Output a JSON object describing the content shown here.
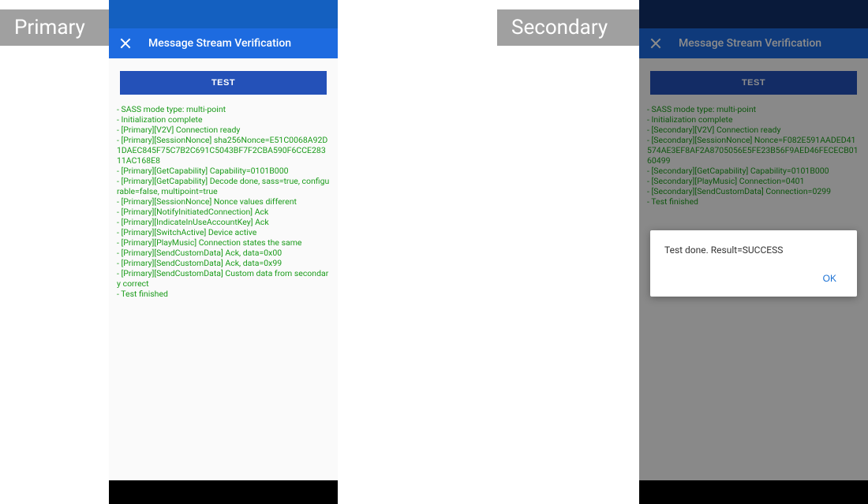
{
  "labels": {
    "primary": "Primary",
    "secondary": "Secondary"
  },
  "app": {
    "title": "Message Stream Verification",
    "test_button": "TEST"
  },
  "primary_log": [
    " - SASS mode type: multi-point",
    " - Initialization complete",
    " - [Primary][V2V] Connection ready",
    " - [Primary][SessionNonce] sha256Nonce=E51C0068A92D1DAEC845F75C7B2C691C5043BF7F2CBA590F6CCE28311AC168E8",
    " - [Primary][GetCapability] Capability=0101B000",
    " - [Primary][GetCapability] Decode done, sass=true, configurable=false, multipoint=true",
    " - [Primary][SessionNonce] Nonce values different",
    " - [Primary][NotifyInitiatedConnection] Ack",
    " - [Primary][IndicateInUseAccountKey] Ack",
    " - [Primary][SwitchActive] Device active",
    " - [Primary][PlayMusic] Connection states the same",
    " - [Primary][SendCustomData] Ack, data=0x00",
    " - [Primary][SendCustomData] Ack, data=0x99",
    " - [Primary][SendCustomData] Custom data from secondary correct",
    " - Test finished"
  ],
  "secondary_log": [
    " - SASS mode type: multi-point",
    " - Initialization complete",
    " - [Secondary][V2V] Connection ready",
    " - [Secondary][SessionNonce] Nonce=F082E591AADED41574AE3EF8AF2A8705056E5FE23B56F9AED46FECECB0160499",
    " - [Secondary][GetCapability] Capability=0101B000",
    " - [Secondary][PlayMusic] Connection=0401",
    " - [Secondary][SendCustomData] Connection=0299",
    " - Test finished"
  ],
  "dialog": {
    "message": "Test done. Result=SUCCESS",
    "ok": "OK"
  }
}
